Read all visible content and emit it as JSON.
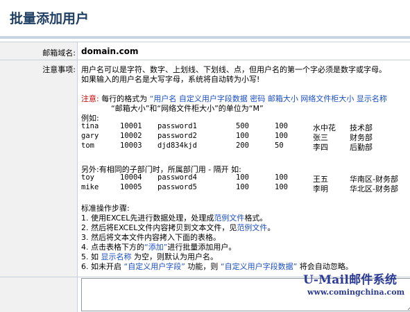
{
  "page": {
    "title": "批量添加用户"
  },
  "form": {
    "domain_label": "邮箱域名:",
    "domain_value": "domain.com",
    "notes_label": "注意事项:",
    "note_line1": "用户名可以是字符、数字、上划线、下划线、点，但用户名的第一个字必须是数字或字母。",
    "note_line2": "如果输入的用户名是大写字母，系统将自动转为小写!",
    "format_prefix": "注意:",
    "format_text": " 每行的格式为 ",
    "format_fields": "“用户名 自定义用户字段数据 密码 邮箱大小 网络文件柜大小 显示名称",
    "unit_line": "“邮箱大小”和“网络文件柜大小”的单位为“M”",
    "example_label": "例如:",
    "example_rows": [
      [
        "tina",
        "10001",
        "password1",
        "500",
        "100",
        "水中花",
        "技术部"
      ],
      [
        "gary",
        "10002",
        "password2",
        "100",
        "100",
        "张三",
        "财务部"
      ],
      [
        "tom",
        "10003",
        "djd834kjd",
        "200",
        "50",
        "李四",
        "后勤部"
      ]
    ],
    "dept_note": "另外:有相同的子部门时，所属部门用 - 隔开 如:",
    "dept_rows": [
      [
        "toy",
        "10004",
        "password4",
        "100",
        "100",
        "王五",
        "华南区-财务部"
      ],
      [
        "mike",
        "10005",
        "password5",
        "100",
        "100",
        "李明",
        "华北区-财务部"
      ]
    ],
    "steps_title": "标准操作步骤:",
    "steps": [
      {
        "pre": "1. 使用EXCEL先进行数据处理，处理成",
        "link": "范例文件",
        "post": "格式。"
      },
      {
        "pre": "2. 然后将EXCEL文件内容拷贝到文本文件，见",
        "link": "范例文件",
        "post": "。"
      },
      {
        "pre": "3. 然后将文本文件内容拷入下面的表格。",
        "link": "",
        "post": ""
      },
      {
        "pre": "4. 点击表格下方的",
        "link": "“添加”",
        "post": "进行批量添加用户。"
      },
      {
        "pre": "5. 如 ",
        "link": "显示名称",
        "post": " 为空，则默认为用户名。"
      },
      {
        "pre": "6. 如未开启 ",
        "link": "“自定义用户字段”",
        "post": " 功能，则 ",
        "link2": "“自定义用户字段数据”",
        "post2": " 将会自动忽略。"
      }
    ]
  },
  "watermark": {
    "brand": "U-Mail邮件系统",
    "url": "www.comingchina.com"
  }
}
